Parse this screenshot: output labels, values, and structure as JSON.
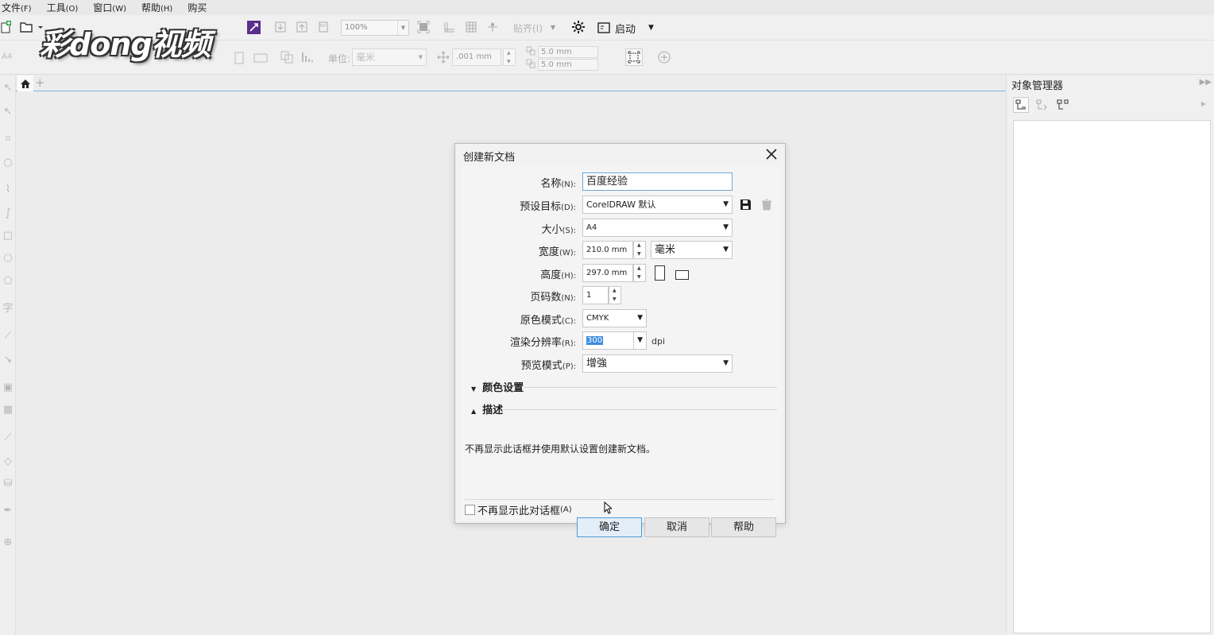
{
  "menubar": {
    "items": [
      {
        "label": "文件",
        "accel": "(F)"
      },
      {
        "label": "工具",
        "accel": "(O)"
      },
      {
        "label": "窗口",
        "accel": "(W)"
      },
      {
        "label": "帮助",
        "accel": "(H)"
      },
      {
        "label": "购买",
        "accel": ""
      }
    ]
  },
  "watermark": {
    "text": "彩dong视频"
  },
  "toolbar": {
    "zoom": "100%",
    "snap_label": "贴齐(I)",
    "launch_label": "启动",
    "paper": "A4",
    "unit_label": "单位:",
    "unit_value": "毫米",
    "nudge": ".001 mm",
    "dup_x": "5.0 mm",
    "dup_y": "5.0 mm"
  },
  "docker": {
    "title": "对象管理器"
  },
  "dialog": {
    "title": "创建新文档",
    "name": {
      "label": "名称",
      "accel": "(N):",
      "value": "百度经验"
    },
    "preset": {
      "label": "预设目标",
      "accel": "(D):",
      "value": "CorelDRAW 默认"
    },
    "size": {
      "label": "大小",
      "accel": "(S):",
      "value": "A4"
    },
    "width": {
      "label": "宽度",
      "accel": "(W):",
      "value": "210.0 mm",
      "unit": "毫米"
    },
    "height": {
      "label": "高度",
      "accel": "(H):",
      "value": "297.0 mm"
    },
    "pages": {
      "label": "页码数",
      "accel": "(N):",
      "value": "1"
    },
    "color_mode": {
      "label": "原色模式",
      "accel": "(C):",
      "value": "CMYK"
    },
    "resolution": {
      "label": "渲染分辨率",
      "accel": "(R):",
      "value": "300",
      "unit": "dpi"
    },
    "preview": {
      "label": "预览模式",
      "accel": "(P):",
      "value": "增強"
    },
    "color_settings": "颜色设置",
    "description_title": "描述",
    "description_text": "不再显示此话框并使用默认设置创建新文档。",
    "dont_show": {
      "label": "不再显示此对话框",
      "accel": "(A)"
    },
    "ok": "确定",
    "cancel": "取消",
    "help": "帮助"
  }
}
